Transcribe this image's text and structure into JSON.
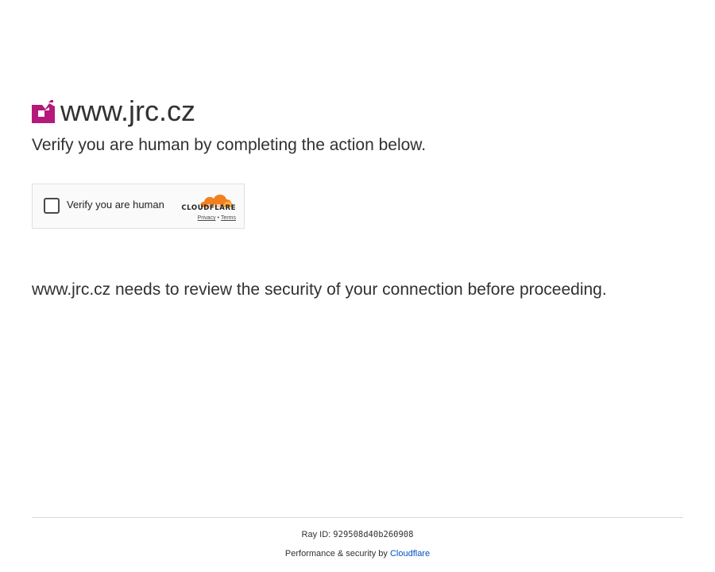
{
  "header": {
    "site_title": "www.jrc.cz",
    "logo_icon": "site-logo-icon",
    "logo_color": "#b5197a"
  },
  "subtitle": "Verify you are human by completing the action below.",
  "widget": {
    "checkbox_label": "Verify you are human",
    "checkbox_checked": false,
    "brand_name": "CLOUDFLARE",
    "brand_icon": "cloudflare-cloud-icon",
    "brand_colors": [
      "#f38020",
      "#faae40"
    ],
    "privacy_link": "Privacy",
    "separator": "•",
    "terms_link": "Terms"
  },
  "security_message": "www.jrc.cz needs to review the security of your connection before proceeding.",
  "footer": {
    "ray_label": "Ray ID:",
    "ray_value": "929508d40b260908",
    "performance_text": "Performance & security by",
    "provider_link": "Cloudflare",
    "link_color": "#0051c3"
  }
}
